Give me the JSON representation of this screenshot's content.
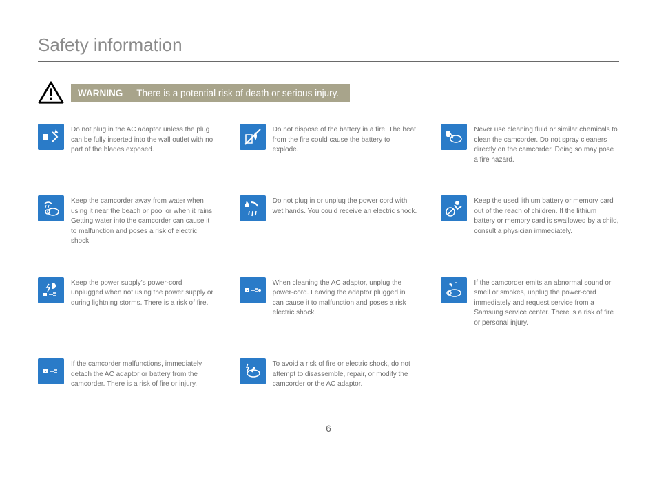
{
  "header": {
    "title": "Safety information"
  },
  "banner": {
    "label": "WARNING",
    "text": "There is a potential risk of death or serious injury."
  },
  "items": [
    {
      "icon": "plug-spark-icon",
      "text": "Do not plug in the AC adaptor unless the plug can be fully inserted into the wall outlet with no part of the blades exposed."
    },
    {
      "icon": "no-fire-icon",
      "text": "Do not dispose of the battery in a fire. The heat from the fire could cause the battery to explode."
    },
    {
      "icon": "no-chemical-icon",
      "text": "Never use cleaning fluid or similar chemicals to clean the camcorder. Do not spray cleaners directly on the camcorder. Doing so may pose a fire hazard."
    },
    {
      "icon": "water-rain-icon",
      "text": "Keep the camcorder away from water when using it near the beach or pool or when it rains. Getting water into the camcorder can cause it to malfunction and poses a risk of electric shock."
    },
    {
      "icon": "wet-hands-icon",
      "text": "Do not plug in or unplug the power cord with wet hands. You could receive an electric shock."
    },
    {
      "icon": "keep-from-children-icon",
      "text": "Keep the used lithium battery or memory card out of the reach of children. If the lithium battery or memory card is swallowed by a child, consult a physician immediately."
    },
    {
      "icon": "lightning-unplug-icon",
      "text": "Keep the power supply's power-cord unplugged when not using the power supply or during lightning storms. There is a risk of fire."
    },
    {
      "icon": "clean-unplug-icon",
      "text": "When cleaning the AC adaptor, unplug the power-cord. Leaving the adaptor plugged in can cause it to malfunction and poses a risk electric shock."
    },
    {
      "icon": "smoke-smell-icon",
      "text": "If the camcorder emits an abnormal sound or smell or smokes, unplug the power-cord immediately and request service from a Samsung service center. There is a risk of fire or personal injury."
    },
    {
      "icon": "detach-battery-icon",
      "text": "If the camcorder malfunctions, immediately detach the AC adaptor or battery from the camcorder. There is a risk of fire or injury."
    },
    {
      "icon": "no-disassemble-icon",
      "text": "To avoid a risk of fire or electric shock, do not attempt to disassemble, repair, or modify the camcorder or the AC adaptor."
    }
  ],
  "page_number": "6"
}
